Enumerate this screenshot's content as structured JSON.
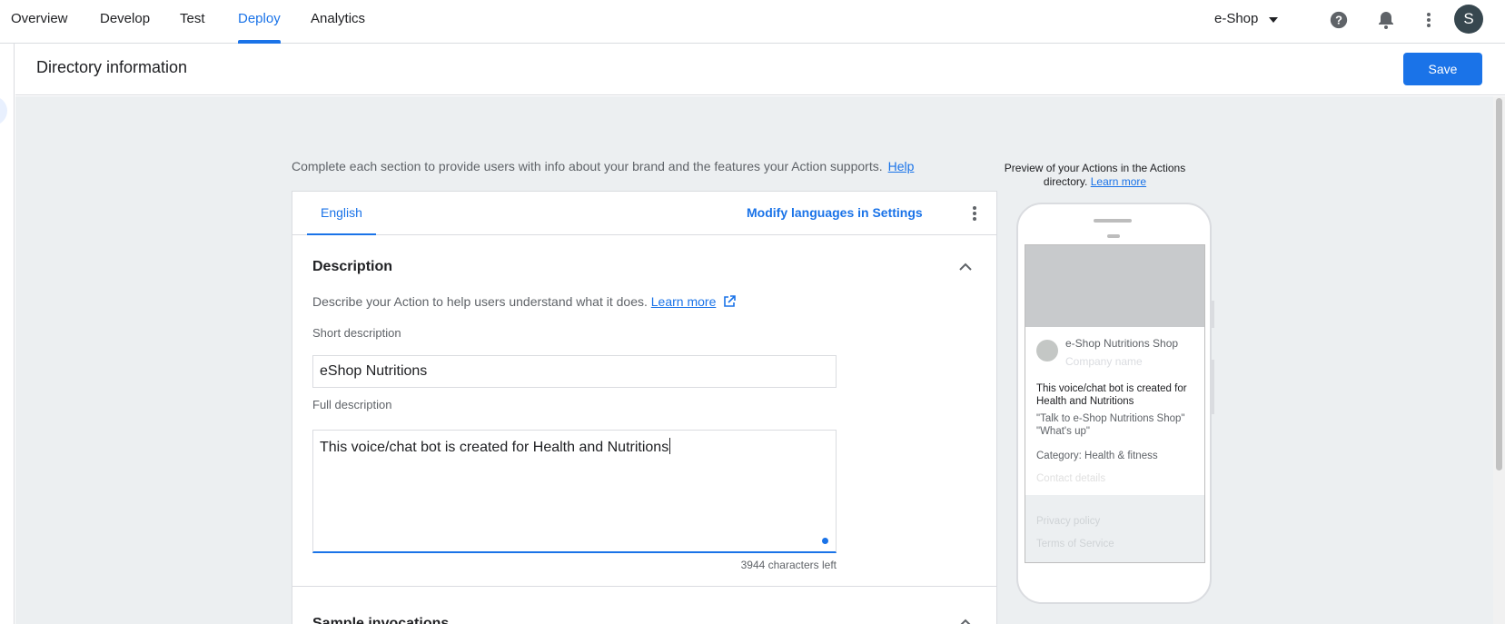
{
  "nav": {
    "tabs": [
      {
        "label": "Overview"
      },
      {
        "label": "Develop"
      },
      {
        "label": "Test"
      },
      {
        "label": "Deploy"
      },
      {
        "label": "Analytics"
      }
    ],
    "active_tab": "Deploy",
    "project": "e-Shop",
    "avatar_letter": "S",
    "icons": [
      "help-icon",
      "notifications-bell-icon",
      "more-vert-icon"
    ]
  },
  "header": {
    "title": "Directory information",
    "save_label": "Save"
  },
  "main": {
    "intro": "Complete each section to provide users with info about your brand and the features your Action supports.",
    "help_link": "Help",
    "language_tab": "English",
    "modify_languages": "Modify languages in Settings",
    "description_section": {
      "title": "Description",
      "helper": "Describe your Action to help users understand what it does.",
      "learn_more": "Learn more",
      "short_label": "Short description",
      "short_value": "eShop Nutritions",
      "full_label": "Full description",
      "full_value": "This voice/chat bot is created for Health and Nutritions",
      "chars_left": "3944 characters left"
    },
    "sample_section": {
      "title": "Sample invocations"
    }
  },
  "preview": {
    "caption": "Preview of your Actions in the Actions directory.",
    "learn_more": "Learn more",
    "name": "e-Shop Nutritions Shop",
    "company_placeholder": "Company name",
    "description": "This voice/chat bot is created for Health and Nutritions",
    "invocation_1": "\"Talk to e-Shop Nutritions Shop\"",
    "invocation_2": "\"What's up\"",
    "category": "Category: Health & fitness",
    "contact": "Contact details",
    "privacy": "Privacy policy",
    "terms": "Terms of Service"
  },
  "colors": {
    "accent": "#1a73e8",
    "background": "#eceff1",
    "avatar": "#37474f"
  }
}
